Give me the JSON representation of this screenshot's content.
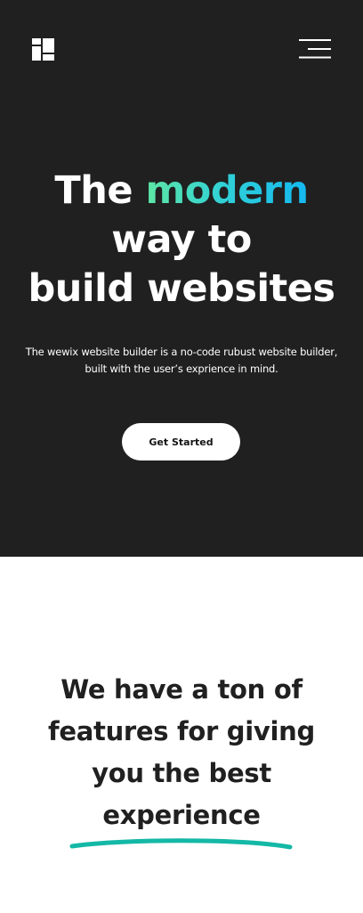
{
  "header": {
    "logo_icon": "grid-logo-icon",
    "menu_icon": "hamburger-menu-icon"
  },
  "hero": {
    "title_word_1": "The",
    "title_accent": "modern",
    "title_line_2": "way to",
    "title_line_3": "build websites",
    "subtitle_line_1": "The wewix website builder is a no-code rubust website builder,",
    "subtitle_line_2": "built with the user’s exprience in mind.",
    "cta_label": "Get Started"
  },
  "features": {
    "heading_line_1": "We have a ton of",
    "heading_line_2": "features for giving",
    "heading_line_3": "you the best",
    "heading_line_4": "experience",
    "underline_color": "#14b8a6"
  },
  "colors": {
    "hero_background": "#202020",
    "accent_gradient_start": "#5ee6a4",
    "accent_gradient_end": "#14b8f0",
    "text_dark": "#202020"
  }
}
